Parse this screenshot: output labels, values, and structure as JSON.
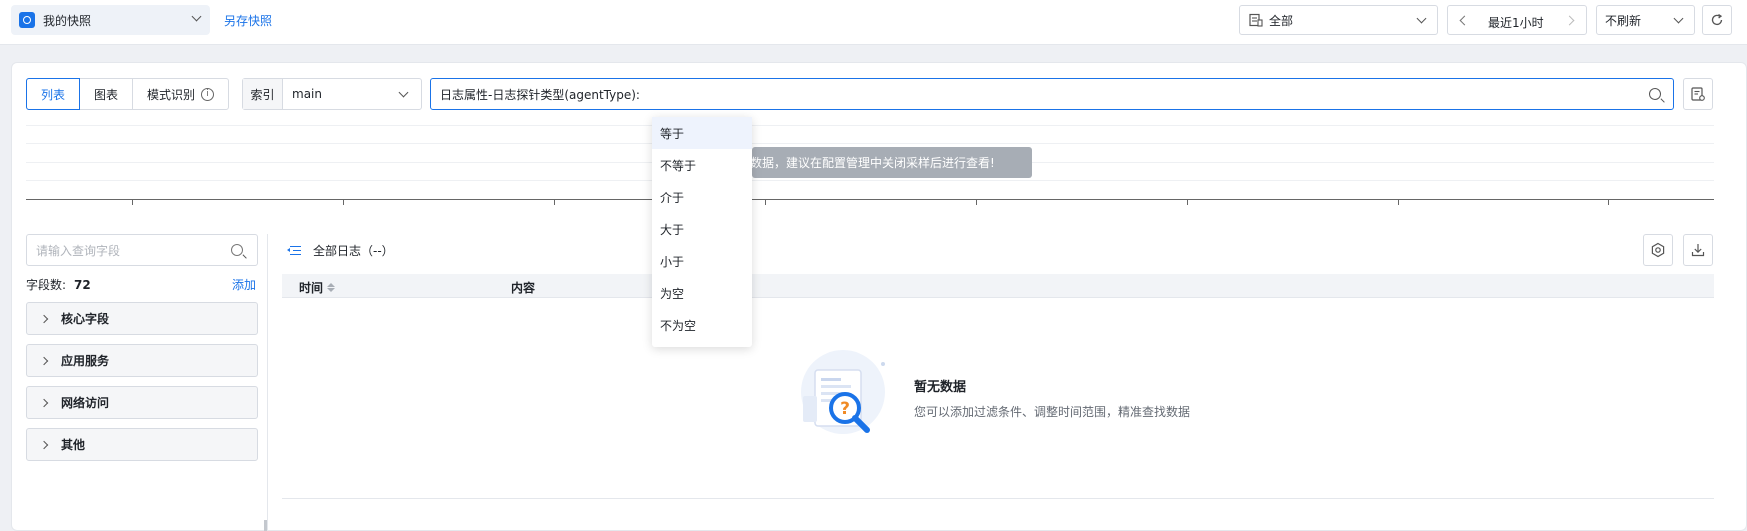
{
  "topbar": {
    "snapshot_label": "我的快照",
    "save_snapshot": "另存快照",
    "scope": "全部",
    "time_range": "最近1小时",
    "refresh": "不刷新"
  },
  "tabs": [
    "列表",
    "图表",
    "模式识别"
  ],
  "index": {
    "label": "索引",
    "value": "main"
  },
  "query": {
    "value": "日志属性-日志探针类型(agentType):"
  },
  "notice": "数据，建议在配置管理中关闭采样后进行查看!",
  "fields": {
    "search_placeholder": "请输入查询字段",
    "count_label": "字段数:",
    "count": "72",
    "add": "添加",
    "groups": [
      "核心字段",
      "应用服务",
      "网络访问",
      "其他"
    ]
  },
  "logs": {
    "title": "全部日志（--）",
    "columns": {
      "time": "时间",
      "content": "内容"
    },
    "empty_title": "暂无数据",
    "empty_desc": "您可以添加过滤条件、调整时间范围，精准查找数据"
  },
  "operators": [
    "等于",
    "不等于",
    "介于",
    "大于",
    "小于",
    "为空",
    "不为空"
  ],
  "colors": {
    "accent": "#1a73e8",
    "notice_bg": "#a7adb5"
  }
}
